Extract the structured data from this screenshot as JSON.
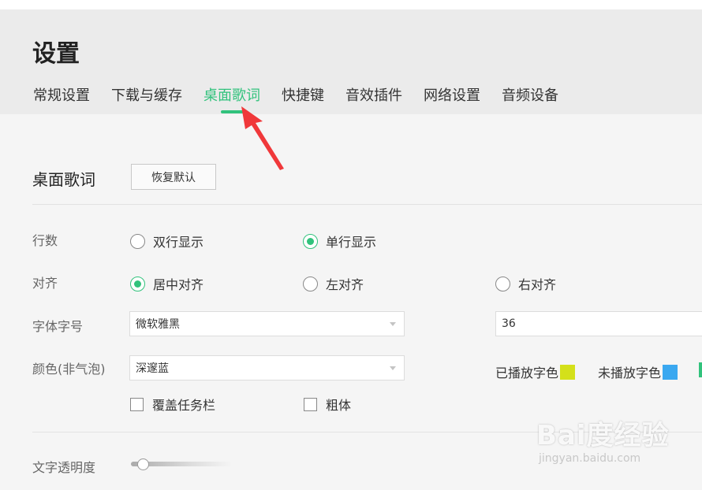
{
  "header": {
    "title": "设置",
    "tabs": [
      {
        "label": "常规设置"
      },
      {
        "label": "下载与缓存"
      },
      {
        "label": "桌面歌词"
      },
      {
        "label": "快捷键"
      },
      {
        "label": "音效插件"
      },
      {
        "label": "网络设置"
      },
      {
        "label": "音频设备"
      }
    ],
    "active_tab": "桌面歌词"
  },
  "section": {
    "title": "桌面歌词",
    "reset_label": "恢复默认"
  },
  "rows": {
    "lines": {
      "label": "行数",
      "options": [
        {
          "label": "双行显示",
          "checked": false
        },
        {
          "label": "单行显示",
          "checked": true
        }
      ]
    },
    "align": {
      "label": "对齐",
      "options": [
        {
          "label": "居中对齐",
          "checked": true
        },
        {
          "label": "左对齐",
          "checked": false
        },
        {
          "label": "右对齐",
          "checked": false
        }
      ]
    },
    "font": {
      "label": "字体字号",
      "family_value": "微软雅黑",
      "size_value": "36"
    },
    "color": {
      "label": "颜色(非气泡)",
      "scheme_value": "深邃蓝",
      "played_label": "已播放字色",
      "played_color": "#d4e01a",
      "unplayed_label": "未播放字色",
      "unplayed_color": "#3aa8f0"
    },
    "options": {
      "cover_taskbar": "覆盖任务栏",
      "bold": "粗体"
    },
    "opacity": {
      "label": "文字透明度",
      "level_fraction": 0.06
    }
  },
  "colors": {
    "accent": "#31c27c",
    "annotation_arrow": "#f0383a"
  },
  "watermark": {
    "main": "Bai度经验",
    "sub": "jingyan.baidu.com"
  }
}
